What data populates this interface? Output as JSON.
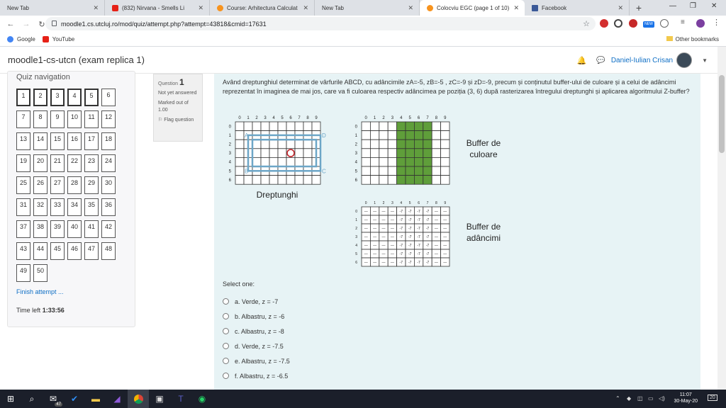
{
  "browser": {
    "tabs": [
      {
        "title": "New Tab",
        "active": false
      },
      {
        "title": "(832) Nirvana - Smells Li",
        "active": false
      },
      {
        "title": "Course: Arhitectura Calculat",
        "active": false
      },
      {
        "title": "New Tab",
        "active": false
      },
      {
        "title": "Colocviu EGC (page 1 of 10)",
        "active": true
      },
      {
        "title": "Facebook",
        "active": false
      }
    ],
    "url": "moodle1.cs.utcluj.ro/mod/quiz/attempt.php?attempt=43818&cmid=17631",
    "bookmarks": [
      "Google",
      "YouTube"
    ],
    "other_bookmarks": "Other bookmarks",
    "ext_badge": "NEW"
  },
  "header": {
    "site_name": "moodle1-cs-utcn (exam replica 1)",
    "user_name": "Daniel-Iulian Crisan"
  },
  "quiz_nav": {
    "title": "Quiz navigation",
    "questions": [
      "1",
      "2",
      "3",
      "4",
      "5",
      "6",
      "7",
      "8",
      "9",
      "10",
      "11",
      "12",
      "13",
      "14",
      "15",
      "16",
      "17",
      "18",
      "19",
      "20",
      "21",
      "22",
      "23",
      "24",
      "25",
      "26",
      "27",
      "28",
      "29",
      "30",
      "31",
      "32",
      "33",
      "34",
      "35",
      "36",
      "37",
      "38",
      "39",
      "40",
      "41",
      "42",
      "43",
      "44",
      "45",
      "46",
      "47",
      "48",
      "49",
      "50"
    ],
    "answered": [
      "1",
      "2",
      "3",
      "4",
      "5"
    ],
    "finish_label": "Finish attempt ...",
    "time_left_label": "Time left",
    "time_left_value": "1:33:56"
  },
  "question_info": {
    "question_label": "Question",
    "question_number": "1",
    "status": "Not yet answered",
    "marked": "Marked out of 1.00",
    "flag_label": "Flag question"
  },
  "question": {
    "text": "Având dreptunghiul determinat de vârfurile ABCD, cu adâncimile zA=-5, zB=-5 , zC=-9 și zD=-9, precum și conținutul buffer-ului de culoare și a celui de adâncimi reprezentat în imaginea de mai jos, care va fi culoarea respectiv adâncimea pe poziția (3, 6) după rasterizarea întregului dreptunghi și aplicarea algoritmului Z-buffer?",
    "rect_grid_label": "Dreptunghi",
    "color_buffer_label_1": "Buffer de",
    "color_buffer_label_2": "culoare",
    "depth_buffer_label_1": "Buffer de",
    "depth_buffer_label_2": "adâncimi",
    "vertex_labels": [
      "A",
      "B",
      "C",
      "D"
    ],
    "col_ticks": [
      "0",
      "1",
      "2",
      "3",
      "4",
      "5",
      "6",
      "7",
      "8",
      "9"
    ],
    "row_ticks": [
      "0",
      "1",
      "2",
      "3",
      "4",
      "5",
      "6"
    ],
    "depth_symbols": {
      "empty": "—",
      "filled": "-7"
    },
    "green_columns": [
      4,
      5,
      6,
      7
    ],
    "select_one": "Select one:",
    "options": [
      "a. Verde, z = -7",
      "b. Albastru, z = -6",
      "c. Albastru, z = -8",
      "d. Verde, z = -7.5",
      "e. Albastru, z = -7.5",
      "f. Albastru, z = -6.5"
    ]
  },
  "colors": {
    "green_fill": "#5f9e3a",
    "rect_outline": "#6da6c7",
    "circle": "#c1272d",
    "question_bg": "#e7f3f5"
  },
  "taskbar": {
    "mail_badge": "47",
    "time": "11:07",
    "date": "30-May-20",
    "notif_count": "20"
  }
}
